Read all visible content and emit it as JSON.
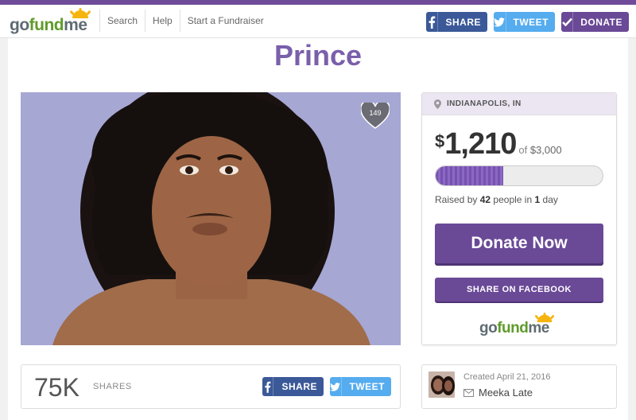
{
  "colors": {
    "brand_purple": "#6a4997",
    "title_purple": "#7a5fab",
    "facebook": "#3b5998",
    "twitter": "#55acee",
    "logo_green": "#5f9b2a"
  },
  "header": {
    "logo": {
      "go": "go",
      "fund": "fund",
      "me": "me"
    },
    "nav": [
      "Search",
      "Help",
      "Start a Fundraiser"
    ],
    "share_label": "SHARE",
    "tweet_label": "TWEET",
    "donate_label": "DONATE",
    "icons": {
      "share": "facebook-f-icon",
      "tweet": "twitter-bird-icon",
      "donate": "checkmark-icon"
    }
  },
  "campaign": {
    "title": "Prince",
    "heart_count": "149",
    "location": "INDIANAPOLIS, IN",
    "currency": "$",
    "raised_amount": "1,210",
    "of_label": "of",
    "goal": "$3,000",
    "progress_fraction": 0.4033,
    "raised_prefix": "Raised by",
    "donor_count": "42",
    "people_mid": "people in",
    "days": "1",
    "day_label": "day",
    "donate_now_label": "Donate Now",
    "share_facebook_label": "SHARE ON FACEBOOK"
  },
  "shares": {
    "count": "75K",
    "label": "SHARES",
    "share_label": "SHARE",
    "tweet_label": "TWEET"
  },
  "creator": {
    "created": "Created April 21, 2016",
    "name": "Meeka Late"
  }
}
